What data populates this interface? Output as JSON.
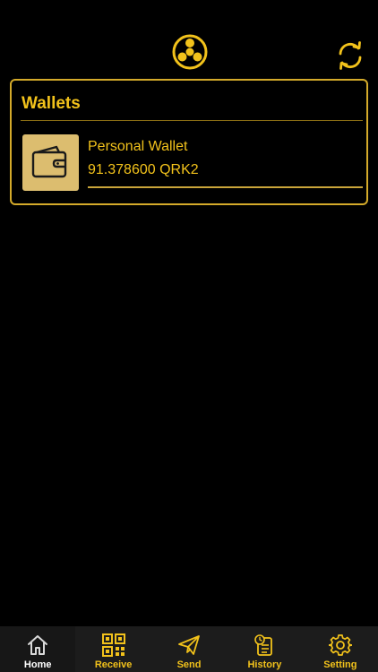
{
  "header": {
    "logo_icon": "qrk-logo-icon",
    "refresh_icon": "refresh-icon"
  },
  "wallets": {
    "title": "Wallets",
    "items": [
      {
        "name": "Personal Wallet",
        "balance": "91.378600 QRK2",
        "icon": "wallet-icon"
      }
    ]
  },
  "tabs": [
    {
      "label": "Home",
      "icon": "home-icon",
      "active": true
    },
    {
      "label": "Receive",
      "icon": "qr-code-icon"
    },
    {
      "label": "Send",
      "icon": "paper-plane-icon"
    },
    {
      "label": "History",
      "icon": "history-icon"
    },
    {
      "label": "Setting",
      "icon": "gear-icon"
    }
  ],
  "colors": {
    "accent": "#f2c21b",
    "background": "#000000",
    "tab_bar": "#1c1c1c",
    "wallet_thumb": "#dcbd6f"
  }
}
